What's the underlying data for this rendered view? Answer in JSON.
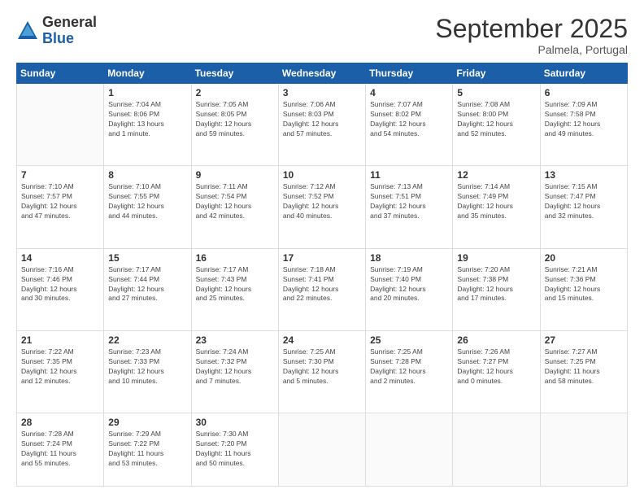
{
  "logo": {
    "general": "General",
    "blue": "Blue"
  },
  "header": {
    "month": "September 2025",
    "location": "Palmela, Portugal"
  },
  "days_of_week": [
    "Sunday",
    "Monday",
    "Tuesday",
    "Wednesday",
    "Thursday",
    "Friday",
    "Saturday"
  ],
  "weeks": [
    [
      {
        "num": "",
        "info": ""
      },
      {
        "num": "1",
        "info": "Sunrise: 7:04 AM\nSunset: 8:06 PM\nDaylight: 13 hours\nand 1 minute."
      },
      {
        "num": "2",
        "info": "Sunrise: 7:05 AM\nSunset: 8:05 PM\nDaylight: 12 hours\nand 59 minutes."
      },
      {
        "num": "3",
        "info": "Sunrise: 7:06 AM\nSunset: 8:03 PM\nDaylight: 12 hours\nand 57 minutes."
      },
      {
        "num": "4",
        "info": "Sunrise: 7:07 AM\nSunset: 8:02 PM\nDaylight: 12 hours\nand 54 minutes."
      },
      {
        "num": "5",
        "info": "Sunrise: 7:08 AM\nSunset: 8:00 PM\nDaylight: 12 hours\nand 52 minutes."
      },
      {
        "num": "6",
        "info": "Sunrise: 7:09 AM\nSunset: 7:58 PM\nDaylight: 12 hours\nand 49 minutes."
      }
    ],
    [
      {
        "num": "7",
        "info": "Sunrise: 7:10 AM\nSunset: 7:57 PM\nDaylight: 12 hours\nand 47 minutes."
      },
      {
        "num": "8",
        "info": "Sunrise: 7:10 AM\nSunset: 7:55 PM\nDaylight: 12 hours\nand 44 minutes."
      },
      {
        "num": "9",
        "info": "Sunrise: 7:11 AM\nSunset: 7:54 PM\nDaylight: 12 hours\nand 42 minutes."
      },
      {
        "num": "10",
        "info": "Sunrise: 7:12 AM\nSunset: 7:52 PM\nDaylight: 12 hours\nand 40 minutes."
      },
      {
        "num": "11",
        "info": "Sunrise: 7:13 AM\nSunset: 7:51 PM\nDaylight: 12 hours\nand 37 minutes."
      },
      {
        "num": "12",
        "info": "Sunrise: 7:14 AM\nSunset: 7:49 PM\nDaylight: 12 hours\nand 35 minutes."
      },
      {
        "num": "13",
        "info": "Sunrise: 7:15 AM\nSunset: 7:47 PM\nDaylight: 12 hours\nand 32 minutes."
      }
    ],
    [
      {
        "num": "14",
        "info": "Sunrise: 7:16 AM\nSunset: 7:46 PM\nDaylight: 12 hours\nand 30 minutes."
      },
      {
        "num": "15",
        "info": "Sunrise: 7:17 AM\nSunset: 7:44 PM\nDaylight: 12 hours\nand 27 minutes."
      },
      {
        "num": "16",
        "info": "Sunrise: 7:17 AM\nSunset: 7:43 PM\nDaylight: 12 hours\nand 25 minutes."
      },
      {
        "num": "17",
        "info": "Sunrise: 7:18 AM\nSunset: 7:41 PM\nDaylight: 12 hours\nand 22 minutes."
      },
      {
        "num": "18",
        "info": "Sunrise: 7:19 AM\nSunset: 7:40 PM\nDaylight: 12 hours\nand 20 minutes."
      },
      {
        "num": "19",
        "info": "Sunrise: 7:20 AM\nSunset: 7:38 PM\nDaylight: 12 hours\nand 17 minutes."
      },
      {
        "num": "20",
        "info": "Sunrise: 7:21 AM\nSunset: 7:36 PM\nDaylight: 12 hours\nand 15 minutes."
      }
    ],
    [
      {
        "num": "21",
        "info": "Sunrise: 7:22 AM\nSunset: 7:35 PM\nDaylight: 12 hours\nand 12 minutes."
      },
      {
        "num": "22",
        "info": "Sunrise: 7:23 AM\nSunset: 7:33 PM\nDaylight: 12 hours\nand 10 minutes."
      },
      {
        "num": "23",
        "info": "Sunrise: 7:24 AM\nSunset: 7:32 PM\nDaylight: 12 hours\nand 7 minutes."
      },
      {
        "num": "24",
        "info": "Sunrise: 7:25 AM\nSunset: 7:30 PM\nDaylight: 12 hours\nand 5 minutes."
      },
      {
        "num": "25",
        "info": "Sunrise: 7:25 AM\nSunset: 7:28 PM\nDaylight: 12 hours\nand 2 minutes."
      },
      {
        "num": "26",
        "info": "Sunrise: 7:26 AM\nSunset: 7:27 PM\nDaylight: 12 hours\nand 0 minutes."
      },
      {
        "num": "27",
        "info": "Sunrise: 7:27 AM\nSunset: 7:25 PM\nDaylight: 11 hours\nand 58 minutes."
      }
    ],
    [
      {
        "num": "28",
        "info": "Sunrise: 7:28 AM\nSunset: 7:24 PM\nDaylight: 11 hours\nand 55 minutes."
      },
      {
        "num": "29",
        "info": "Sunrise: 7:29 AM\nSunset: 7:22 PM\nDaylight: 11 hours\nand 53 minutes."
      },
      {
        "num": "30",
        "info": "Sunrise: 7:30 AM\nSunset: 7:20 PM\nDaylight: 11 hours\nand 50 minutes."
      },
      {
        "num": "",
        "info": ""
      },
      {
        "num": "",
        "info": ""
      },
      {
        "num": "",
        "info": ""
      },
      {
        "num": "",
        "info": ""
      }
    ]
  ]
}
